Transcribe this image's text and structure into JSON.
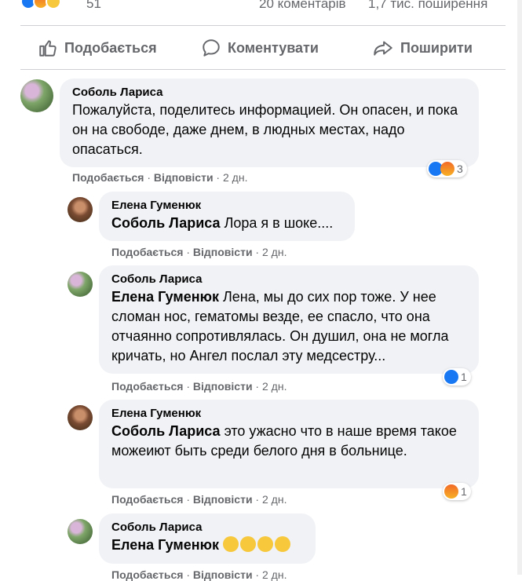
{
  "post_stats": {
    "reaction_count": "51",
    "comments": "20 коментарів",
    "shares": "1,7 тис. поширення"
  },
  "actions": {
    "like": "Подобається",
    "comment": "Коментувати",
    "share": "Поширити"
  },
  "comments": [
    {
      "author": "Соболь Лариса",
      "tag": "",
      "text": "Пожалуйста, поделитесь информацией. Он опасен, и пока он на свободе, даже днем, в людных местах, надо опасаться.",
      "like_label": "Подобається",
      "reply_label": "Відповісти",
      "time": "2 дн.",
      "reaction_count": "3"
    },
    {
      "author": "Елена Гуменюк",
      "tag": "Соболь Лариса",
      "text": "Лора я в шоке....",
      "like_label": "Подобається",
      "reply_label": "Відповісти",
      "time": "2 дн."
    },
    {
      "author": "Соболь Лариса",
      "tag": "Елена Гуменюк",
      "text": "Лена, мы до сих пор тоже. У нее сломан нос, гематомы везде, ее спасло, что она отчаянно сопротивлялась. Он душил, она не могла кричать, но Ангел послал эту медсестру...",
      "like_label": "Подобається",
      "reply_label": "Відповісти",
      "time": "2 дн.",
      "reaction_count": "1"
    },
    {
      "author": "Елена Гуменюк",
      "tag": "Соболь Лариса",
      "text": "это ужасно что в наше время такое можеиют быть среди белого дня в больнице.",
      "like_label": "Подобається",
      "reply_label": "Відповісти",
      "time": "2 дн.",
      "reaction_count": "1"
    },
    {
      "author": "Соболь Лариса",
      "tag": "Елена Гуменюк",
      "text": "",
      "like_label": "Подобається",
      "reply_label": "Відповісти",
      "time": "2 дн."
    }
  ],
  "colors": {
    "like_blue": "#1877f2",
    "angry_orange": "#f26a28",
    "bubble_bg": "#f0f2f5",
    "meta_gray": "#65676b"
  }
}
